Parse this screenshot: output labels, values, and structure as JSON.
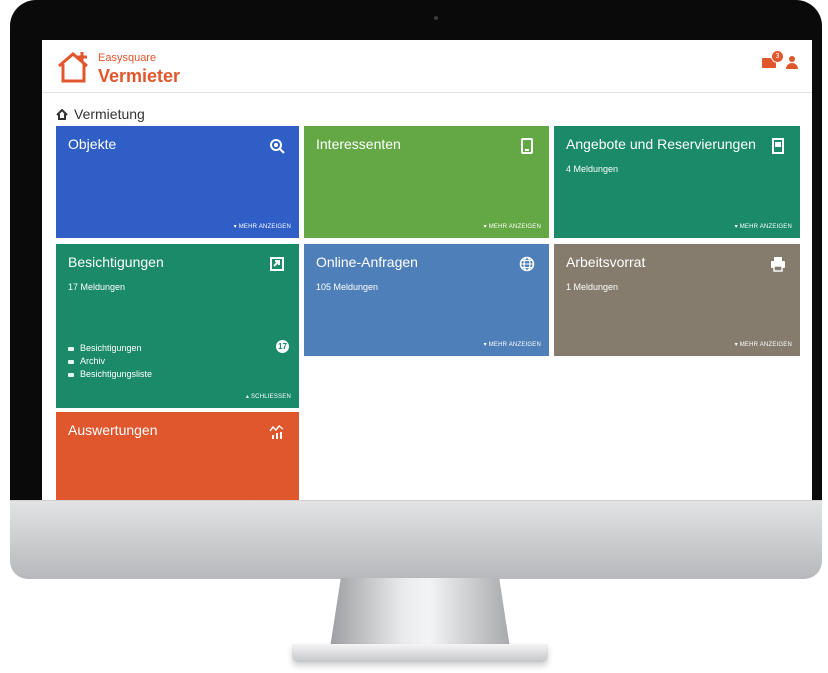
{
  "app": {
    "brand_small": "Easysquare",
    "brand_main": "Vermieter",
    "mail_badge": "3"
  },
  "breadcrumb": {
    "label": "Vermietung"
  },
  "tiles": {
    "objekte": {
      "title": "Objekte",
      "more": "▾ MEHR ANZEIGEN",
      "color": "#2f5ec6",
      "icon": "search-icon"
    },
    "interessenten": {
      "title": "Interessenten",
      "more": "▾ MEHR ANZEIGEN",
      "color": "#63a844",
      "icon": "tablet-icon"
    },
    "angebote": {
      "title": "Angebote und Reservierungen",
      "sub": "4 Meldungen",
      "more": "▾ MEHR ANZEIGEN",
      "color": "#1a8a69",
      "icon": "document-icon"
    },
    "besichtigungen": {
      "title": "Besichtigungen",
      "sub": "17 Meldungen",
      "count": "17",
      "close": "▴ SCHLIESSEN",
      "color": "#1a8a69",
      "icon": "expand-icon",
      "items": [
        "Besichtigungen",
        "Archiv",
        "Besichtigungsliste"
      ]
    },
    "online": {
      "title": "Online-Anfragen",
      "sub": "105 Meldungen",
      "more": "▾ MEHR ANZEIGEN",
      "color": "#4f7fb8",
      "icon": "globe-icon"
    },
    "arbeitsvorrat": {
      "title": "Arbeitsvorrat",
      "sub": "1 Meldungen",
      "more": "▾ MEHR ANZEIGEN",
      "color": "#857c6e",
      "icon": "printer-icon"
    },
    "auswertungen": {
      "title": "Auswertungen",
      "color": "#e0562d",
      "icon": "chart-icon"
    }
  }
}
